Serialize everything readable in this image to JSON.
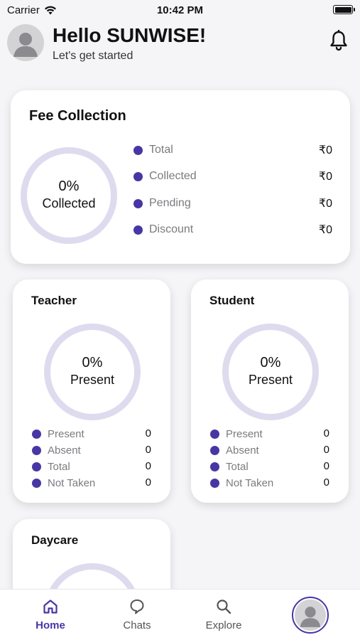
{
  "status_bar": {
    "carrier": "Carrier",
    "time": "10:42 PM"
  },
  "header": {
    "greeting": "Hello SUNWISE!",
    "subtitle": "Let's get started",
    "notification_icon": "bell-icon"
  },
  "fee_collection": {
    "title": "Fee Collection",
    "percent": "0%",
    "percent_label": "Collected",
    "progress": 0,
    "items": [
      {
        "label": "Total",
        "value": "₹0"
      },
      {
        "label": "Collected",
        "value": "₹0"
      },
      {
        "label": "Pending",
        "value": "₹0"
      },
      {
        "label": "Discount",
        "value": "₹0"
      }
    ]
  },
  "teacher": {
    "title": "Teacher",
    "percent": "0%",
    "percent_label": "Present",
    "progress": 0,
    "items": [
      {
        "label": "Present",
        "value": "0"
      },
      {
        "label": "Absent",
        "value": "0"
      },
      {
        "label": "Total",
        "value": "0"
      },
      {
        "label": "Not Taken",
        "value": "0"
      }
    ]
  },
  "student": {
    "title": "Student",
    "percent": "0%",
    "percent_label": "Present",
    "progress": 0,
    "items": [
      {
        "label": "Present",
        "value": "0"
      },
      {
        "label": "Absent",
        "value": "0"
      },
      {
        "label": "Total",
        "value": "0"
      },
      {
        "label": "Not Taken",
        "value": "0"
      }
    ]
  },
  "daycare": {
    "title": "Daycare"
  },
  "tabbar": {
    "tabs": [
      {
        "label": "Home",
        "icon": "home-icon",
        "active": true
      },
      {
        "label": "Chats",
        "icon": "chat-icon",
        "active": false
      },
      {
        "label": "Explore",
        "icon": "search-icon",
        "active": false
      }
    ],
    "profile_icon": "avatar"
  },
  "colors": {
    "accent": "#4637a4",
    "ring_track": "#dedbee",
    "background": "#f5f4f7"
  }
}
